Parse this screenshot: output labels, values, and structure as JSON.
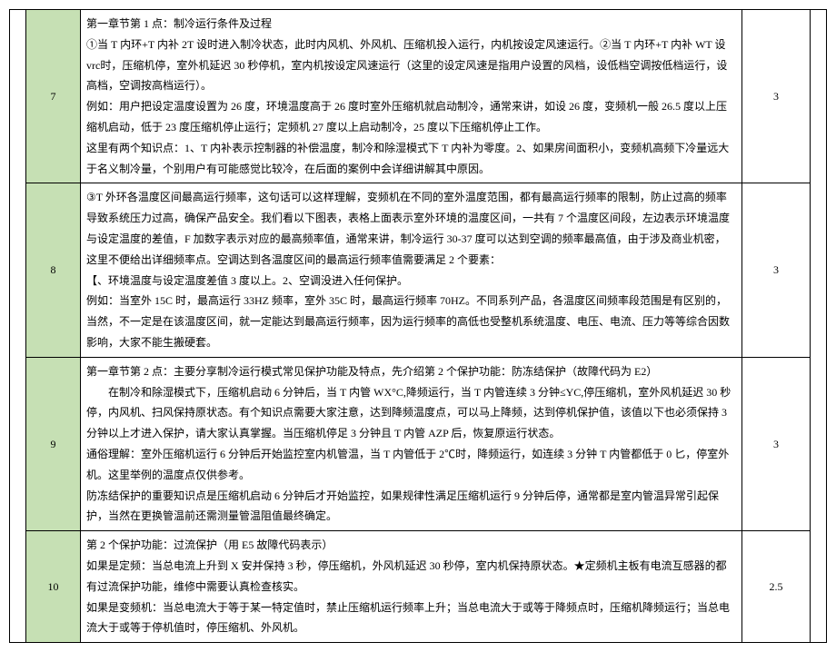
{
  "rows": [
    {
      "num": "7",
      "score": "3",
      "p1": "第一章节第 1 点：制冷运行条件及过程",
      "p2": "①当 T 内环+T 内补 2T 设时进入制冷状态，此时内风机、外风机、压缩机投入运行，内机按设定风速运行。②当 T 内环+T 内补 WT 设vrc时，压缩机停，室外机延迟 30 秒停机，室内机按设定风速运行（这里的设定风速是指用户设置的风档，设低档空调按低档运行，设高档，空调按高档运行）。",
      "p3": "例如：用户把设定温度设置为 26 度，环境温度高于 26 度时室外压缩机就启动制冷，通常来讲，如设 26 度，变频机一般 26.5 度以上压缩机启动，低于 23 度压缩机停止运行；定频机 27 度以上启动制冷，25 度以下压缩机停止工作。",
      "p4": "这里有两个知识点：1、T 内补表示控制器的补偿温度，制冷和除湿模式下 T 内补为零度。2、如果房间面积小，变频机高频下冷量远大于名义制冷量，个别用户有可能感觉比较冷，在后面的案例中会详细讲解其中原因。"
    },
    {
      "num": "8",
      "score": "3",
      "p1": "③T 外环各温度区间最高运行频率，这句话可以这样理解，变频机在不同的室外温度范围，都有最高运行频率的限制，防止过高的频率导致系统压力过高，确保产品安全。我们看以下图表，表格上面表示室外环境的温度区间，一共有 7 个温度区间段，左边表示环境温度与设定温度的差值，F 加数字表示对应的最高频率值，通常来讲，制冷运行 30-37 度可以达到空调的频率最高值，由于涉及商业机密，这里不便给出详细频率点。空调达到各温度区间的最高运行频率值需要满足 2 个要素：",
      "p2": "【、环境温度与设定温度差值 3 度以上。2、空调没进入任何保护。",
      "p3": "例如：当室外 15C 时，最高运行 33HZ 频率，室外 35C 时，最高运行频率 70HZ。不同系列产品，各温度区间频率段范围是有区别的，当然，不一定是在该温度区间，就一定能达到最高运行频率，因为运行频率的高低也受整机系统温度、电压、电流、压力等等综合因数影响，大家不能生搬硬套。"
    },
    {
      "num": "9",
      "score": "3",
      "p1": "第一章节第 2 点：主要分享制冷运行模式常见保护功能及特点，先介绍第 2 个保护功能：防冻结保护（故障代码为 E2）",
      "p2_indent": "在制冷和除湿模式下，压缩机启动 6 分钟后，当 T 内管 WX°C,降频运行，当 T 内管连续 3 分钟≤YC,停压缩机，室外风机延迟 30 秒停，内风机、扫风保持原状态。有个知识点需要大家注意，达到降频温度点，可以马上降频，达到停机保护值，该值以下也必须保持 3 分钟以上才进入保护，请大家认真掌握。当压缩机停足 3 分钟且 T 内管 AZP 后，恢复原运行状态。",
      "p3": "通俗理解：室外压缩机运行 6 分钟后开始监控室内机管温，当 T 内管低于 2℃时，降频运行，如连续 3 分钟 T 内管都低于 0 匕，停室外机。这里举例的温度点仅供参考。",
      "p4": "防冻结保护的重要知识点是压缩机启动 6 分钟后才开始监控，如果规律性满足压缩机运行 9 分钟后停，通常都是室内管温异常引起保护，当然在更换管温前还需测量管温阻值最终确定。"
    },
    {
      "num": "10",
      "score": "2.5",
      "p1": "第 2 个保护功能：过流保护（用 E5 故障代码表示）",
      "p2": "如果是定频：当总电流上升到 X 安并保持 3 秒，停压缩机，外风机延迟 30 秒停，室内机保持原状态。★定频机主板有电流互感器的都有过流保护功能，维修中需要认真检查核实。",
      "p3": "如果是变频机：当总电流大于等于某一特定值时，禁止压缩机运行频率上升；当总电流大于或等于降频点时，压缩机降频运行；当总电流大于或等于停机值时，停压缩机、外风机。"
    }
  ]
}
